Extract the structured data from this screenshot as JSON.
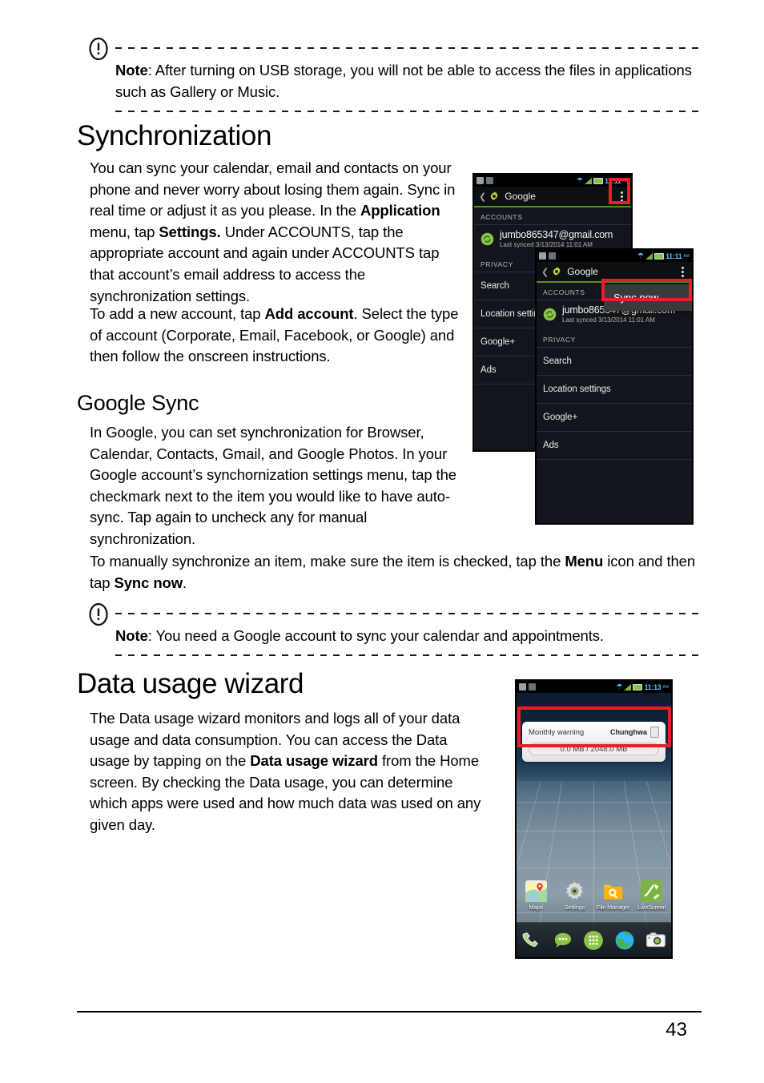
{
  "notes": [
    {
      "icon": "exclamation-circle-icon",
      "label": "Note",
      "text": ": After turning on USB storage, you will not be able to access the files in applications such as Gallery or Music."
    },
    {
      "icon": "exclamation-circle-icon",
      "label": "Note",
      "text": ": You need a Google account to sync your calendar and appointments."
    }
  ],
  "sections": {
    "synchronization": {
      "heading": "Synchronization",
      "p1_a": "You can sync your calendar, email and contacts on your phone and never worry about losing them again. Sync in real time or adjust it as you please. In the ",
      "p1_b1": "Application",
      "p1_c": " menu, tap ",
      "p1_b2": "Settings.",
      "p1_d": " Under ACCOUNTS, tap the appropriate account and again under ACCOUNTS tap that account’s email address to access the synchronization settings.",
      "p2_a": "To add a new account, tap ",
      "p2_b": "Add account",
      "p2_c": ". Select the type of account (Corporate, Email, Facebook, or Google) and then follow the onscreen instructions."
    },
    "google_sync": {
      "heading": "Google Sync",
      "p1": "In Google, you can set synchronization for Browser, Calendar, Contacts, Gmail, and Google Photos. In your Google account’s synchornization settings menu, tap the checkmark next to the item you would like to have auto-sync. Tap again to uncheck any for manual synchronization.",
      "p2_a": "To manually synchronize an item, make sure the item is checked, tap the ",
      "p2_b": "Menu",
      "p2_c": " icon and then tap ",
      "p2_d": "Sync now",
      "p2_e": "."
    },
    "data_usage_wizard": {
      "heading": "Data usage wizard",
      "p1_a": "The Data usage wizard monitors and logs all of your data usage and data consumption. You can access the Data usage by tapping on the ",
      "p1_b": "Data usage wizard",
      "p1_c": " from the Home screen. By checking the Data usage, you can determine which apps were used and how much data was used on any given day."
    }
  },
  "figures": {
    "google_settings_back": {
      "status_time": "11:11",
      "status_ampm": "AM",
      "title": "Google",
      "accounts_header": "ACCOUNTS",
      "account_email": "jumbo865347@gmail.com",
      "account_subtitle": "Last synced 3/13/2014 11:01 AM",
      "privacy_header": "PRIVACY",
      "items": [
        "Search",
        "Location settings",
        "Google+",
        "Ads"
      ],
      "highlight": "menu-overflow-icon"
    },
    "google_settings_front": {
      "status_time": "11:11",
      "status_ampm": "AM",
      "title": "Google",
      "accounts_header": "ACCOUNTS",
      "account_email": "jumbo865347@gmail.com",
      "account_subtitle": "Last synced 3/13/2014 11:01 AM",
      "privacy_header": "PRIVACY",
      "items": [
        "Search",
        "Location settings",
        "Google+",
        "Ads"
      ],
      "popup_label": "Sync now",
      "highlight": "sync-now-menu-item"
    },
    "home_screen": {
      "status_time": "11:13",
      "status_ampm": "AM",
      "widget": {
        "title": "Monthly warning",
        "carrier": "Chunghwa",
        "usage": "0.0 MB / 2048.0 MB"
      },
      "apps": [
        {
          "label": "Maps",
          "icon": "maps-icon"
        },
        {
          "label": "Settings",
          "icon": "gear-icon"
        },
        {
          "label": "File Manager",
          "icon": "folder-search-icon"
        },
        {
          "label": "LiveScreen",
          "icon": "livescreen-icon"
        }
      ],
      "dock": [
        {
          "icon": "phone-icon"
        },
        {
          "icon": "messages-icon"
        },
        {
          "icon": "app-drawer-icon"
        },
        {
          "icon": "browser-globe-icon"
        },
        {
          "icon": "camera-icon"
        }
      ]
    }
  },
  "footer": {
    "page_number": "43"
  },
  "colors": {
    "highlight_red": "#ee1c25",
    "android_green": "#8bc34a",
    "status_time_blue": "#4fc3f7"
  }
}
